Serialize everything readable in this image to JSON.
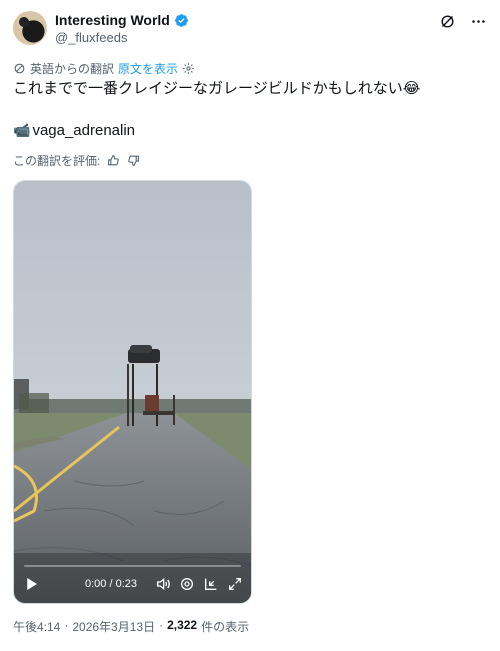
{
  "author": {
    "name": "Interesting World",
    "handle": "@_fluxfeeds",
    "verified_color": "#1d9bf0"
  },
  "top_icons": [
    "grok-icon",
    "more-icon"
  ],
  "translation": {
    "label": "英語からの翻訳",
    "show_original": "原文を表示"
  },
  "tweet": {
    "text": "これまでで一番クレイジーなガレージビルドかもしれない😂",
    "credit_emoji": "📹",
    "credit": "vaga_adrenalin"
  },
  "rate": {
    "label": "この翻訳を評価:"
  },
  "video": {
    "time": "0:00 / 0:23",
    "progress": 0
  },
  "meta": {
    "time": "午後4:14",
    "sep1": "·",
    "date": "2026年3月13日",
    "sep2": "·",
    "views_count": "2,322",
    "views_label": "件の表示"
  },
  "colors": {
    "text": "#0f1419",
    "secondary": "#536471",
    "link": "#1d9bf0"
  }
}
